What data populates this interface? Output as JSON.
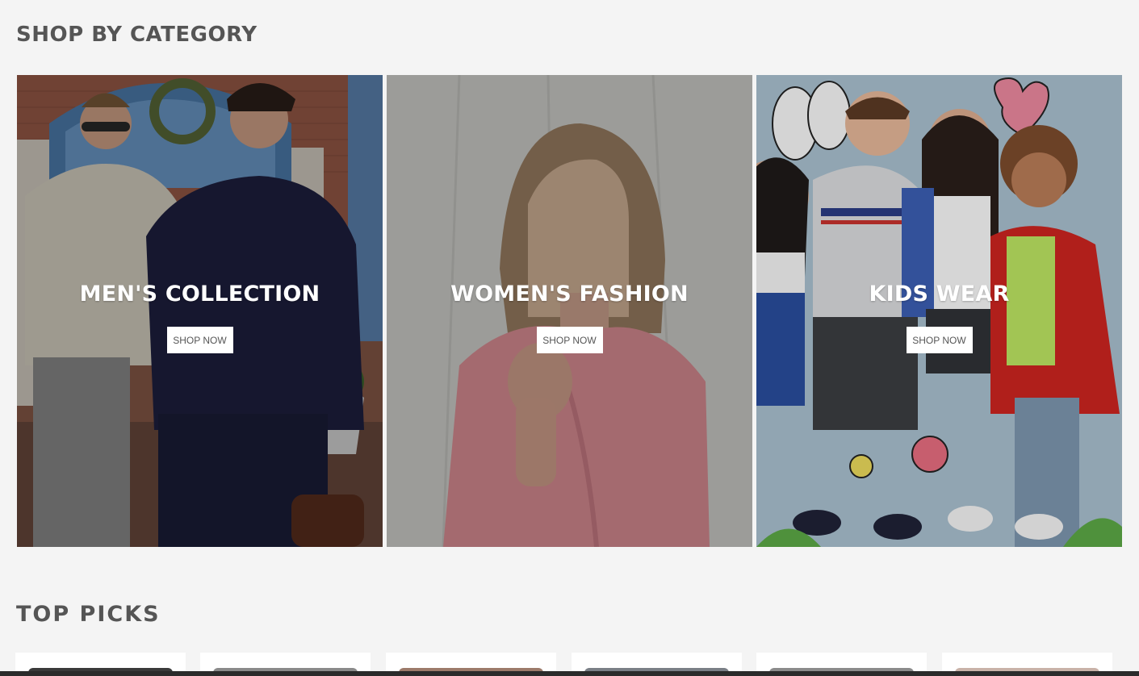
{
  "sections": {
    "shop_by_category": "SHOP BY CATEGORY",
    "top_picks": "TOP PICKS"
  },
  "categories": [
    {
      "title": "MEN'S COLLECTION",
      "button": "SHOP NOW"
    },
    {
      "title": "WOMEN'S FASHION",
      "button": "SHOP NOW"
    },
    {
      "title": "KIDS WEAR",
      "button": "SHOP NOW"
    }
  ],
  "top_picks_count": 6,
  "colors": {
    "background": "#f4f4f4",
    "heading": "#555555",
    "button_bg": "#ffffff",
    "button_text": "#555555",
    "card_title": "#ffffff"
  }
}
